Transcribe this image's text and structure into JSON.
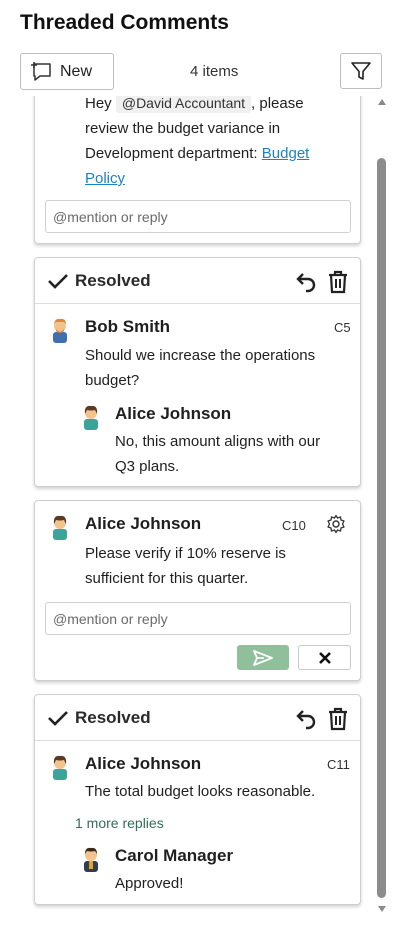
{
  "panel": {
    "title": "Threaded Comments",
    "new_label": "New",
    "count_label": "4 items"
  },
  "comments": [
    {
      "id": "card1",
      "text_prefix": "Hey",
      "mention": "@David Accountant",
      "text_middle_1": ", please",
      "text_line_2": "review the budget variance in",
      "text_line_3": "Development department:",
      "link_line_1": "Budget",
      "link_line_2": "Policy",
      "reply_placeholder": "@mention or reply"
    },
    {
      "id": "card2",
      "status": "Resolved",
      "author": "Bob Smith",
      "cid": "C5",
      "text_1": "Should we increase the operations",
      "text_2": "budget?",
      "reply": {
        "author": "Alice Johnson",
        "text_1": "No, this amount aligns with our",
        "text_2": "Q3 plans."
      }
    },
    {
      "id": "card3",
      "author": "Alice Johnson",
      "cid": "C10",
      "text_1": "Please verify if 10% reserve is",
      "text_2": "sufficient for this quarter.",
      "reply_placeholder": "@mention or reply"
    },
    {
      "id": "card4",
      "status": "Resolved",
      "author": "Alice Johnson",
      "cid": "C11",
      "text_1": "The total budget looks reasonable.",
      "more_replies": "1 more replies",
      "reply": {
        "author": "Carol Manager",
        "text": "Approved!"
      }
    }
  ],
  "icons": {
    "new": "add-comment-icon",
    "filter": "filter-icon",
    "check": "check-icon",
    "reopen": "undo-icon",
    "trash": "trash-icon",
    "settings": "gear-icon",
    "send": "send-icon",
    "cancel": "close-icon"
  },
  "colors": {
    "link": "#1a83c6",
    "send_button": "#8fbf9b",
    "more_replies": "#2f6f5a",
    "scrollbar": "#8c8c8c"
  }
}
